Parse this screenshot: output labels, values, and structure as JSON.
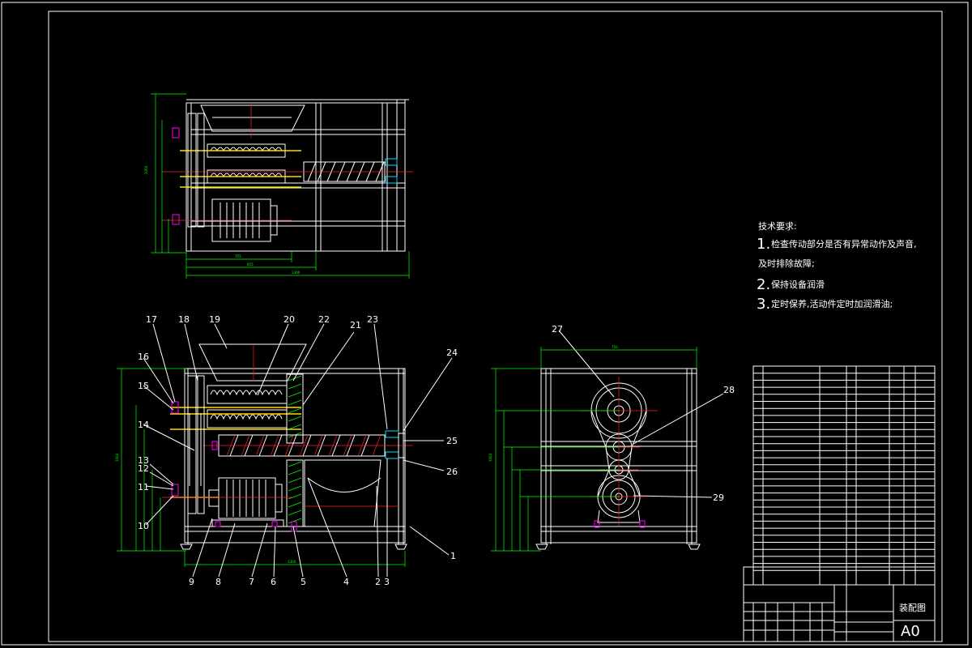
{
  "tech_requirements": {
    "heading": "技术要求:",
    "item1_num": "1.",
    "item1_text": "检查传动部分是否有异常动作及声音,",
    "item1_cont": "及时排除故障;",
    "item2_num": "2.",
    "item2_text": "保持设备润滑",
    "item3_num": "3.",
    "item3_text": "定时保养,活动件定时加润滑油;"
  },
  "part_callouts": [
    "1",
    "2",
    "3",
    "4",
    "5",
    "6",
    "7",
    "8",
    "9",
    "10",
    "11",
    "12",
    "13",
    "14",
    "15",
    "16",
    "17",
    "18",
    "19",
    "20",
    "21",
    "22",
    "23",
    "24",
    "25",
    "26",
    "27",
    "28",
    "29"
  ],
  "title_block": {
    "drawing_name": "装配图",
    "sheet_size": "A0"
  },
  "colors": {
    "background": "#000000",
    "outline": "#ffffff",
    "dimension": "#00ff00",
    "centerline": "#ff2020",
    "shaft": "#ffd800",
    "fastener": "#ff00ff",
    "bearing": "#00d8ff"
  }
}
